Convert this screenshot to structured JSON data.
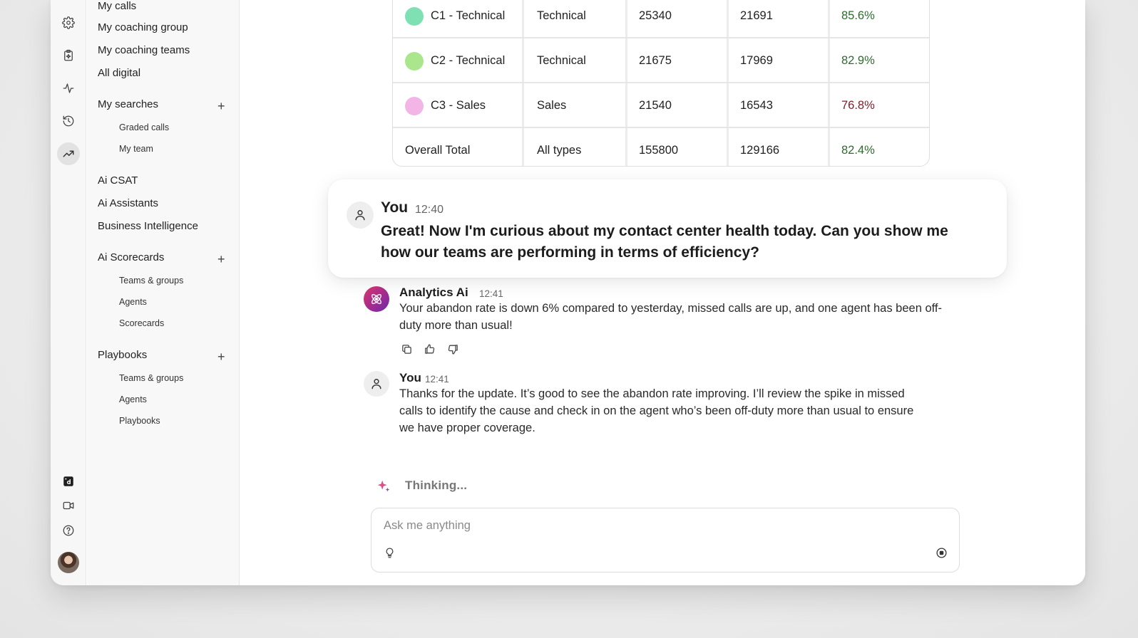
{
  "rail": {
    "icons": [
      "gear-icon",
      "clipboard-sparkle-icon",
      "pulse-icon",
      "history-icon",
      "trending-up-icon",
      "dialpad-logo-icon",
      "video-icon",
      "help-icon"
    ],
    "active": "trending-up-icon"
  },
  "sidebar": {
    "items": {
      "my_calls": "My calls",
      "my_coaching_group": "My coaching group",
      "my_coaching_teams": "My coaching teams",
      "all_digital": "All digital",
      "my_searches": "My searches",
      "graded_calls": "Graded calls",
      "my_team": "My team",
      "ai_csat": "Ai CSAT",
      "ai_assistants": "Ai Assistants",
      "business_intelligence": "Business Intelligence",
      "ai_scorecards": "Ai Scorecards",
      "sc_teams_groups": "Teams & groups",
      "sc_agents": "Agents",
      "sc_scorecards": "Scorecards",
      "playbooks": "Playbooks",
      "pb_teams_groups": "Teams & groups",
      "pb_agents": "Agents",
      "pb_playbooks": "Playbooks"
    },
    "plus": "+"
  },
  "table": {
    "rows": [
      {
        "name": "C1 - Technical",
        "type": "Technical",
        "a": "25340",
        "b": "21691",
        "pct": "85.6%",
        "dot": "#7fe0b4",
        "pct_status": "good"
      },
      {
        "name": "C2 - Technical",
        "type": "Technical",
        "a": "21675",
        "b": "17969",
        "pct": "82.9%",
        "dot": "#a9e68c",
        "pct_status": "good"
      },
      {
        "name": "C3 - Sales",
        "type": "Sales",
        "a": "21540",
        "b": "16543",
        "pct": "76.8%",
        "dot": "#f2b5e6",
        "pct_status": "bad"
      },
      {
        "name": "Overall Total",
        "type": "All types",
        "a": "155800",
        "b": "129166",
        "pct": "82.4%",
        "dot": null,
        "pct_status": "good"
      }
    ]
  },
  "messages": {
    "you1": {
      "name": "You",
      "time": "12:40",
      "text": "Great! Now I'm curious about my contact center health today. Can you show me how our teams are performing in terms of efficiency?"
    },
    "ai": {
      "name": "Analytics Ai",
      "time": "12:41",
      "text": "Your abandon rate is down 6% compared to yesterday, missed calls are up, and one agent has been off-duty more than usual!"
    },
    "you2": {
      "name": "You",
      "time": "12:41",
      "text": "Thanks for the update. It’s good to see the abandon rate improving. I’ll review the spike in missed calls to identify the cause and check in on the agent who’s been off-duty more than usual to ensure we have proper coverage."
    }
  },
  "status": {
    "thinking": "Thinking..."
  },
  "composer": {
    "placeholder": "Ask me anything",
    "value": ""
  },
  "colors": {
    "good": "#2e6b2e",
    "bad": "#7a1f2a",
    "ai_gradient_start": "#d8366b",
    "ai_gradient_end": "#6a2bb0"
  }
}
